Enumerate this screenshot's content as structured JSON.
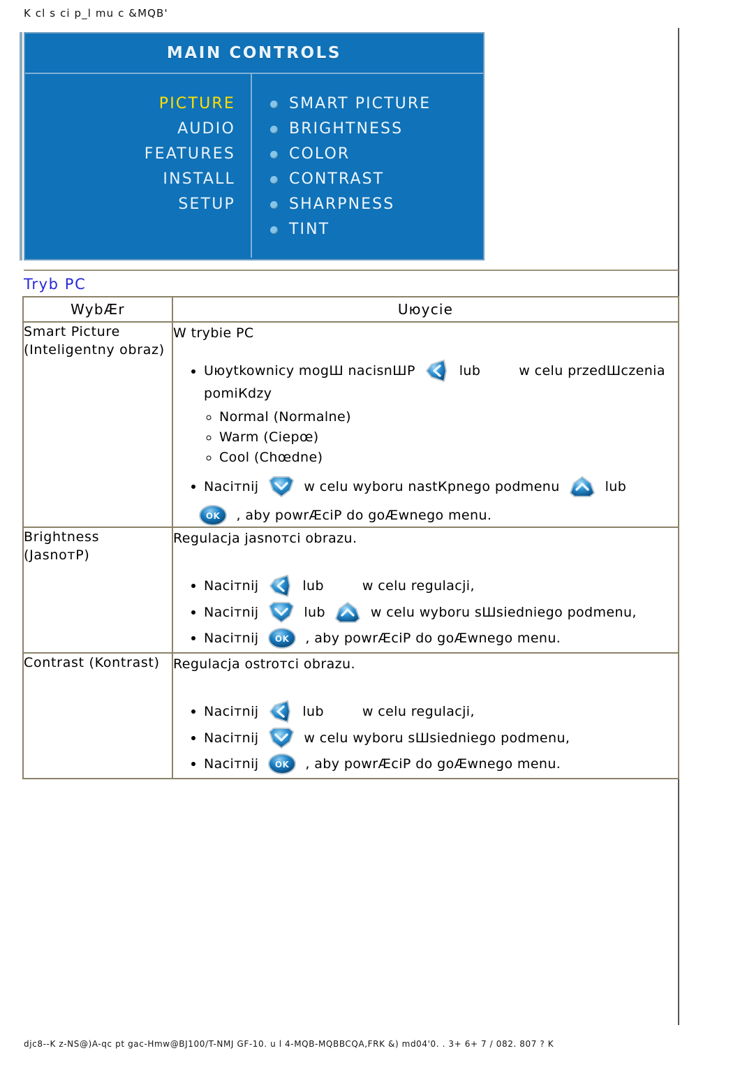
{
  "header": {
    "breadcrumb": "K cl s ci p_l mu c &MQB'"
  },
  "osd": {
    "title": "MAIN  CONTROLS",
    "categories": [
      {
        "label": "PICTURE",
        "selected": true
      },
      {
        "label": "AUDIO",
        "selected": false
      },
      {
        "label": "FEATURES",
        "selected": false
      },
      {
        "label": "INSTALL",
        "selected": false
      },
      {
        "label": "SETUP",
        "selected": false
      }
    ],
    "submenu": [
      "SMART PICTURE",
      "BRIGHTNESS",
      "COLOR",
      "CONTRAST",
      "SHARPNESS",
      "TINT"
    ],
    "colors": {
      "background": "#1072b8",
      "border": "#6f9fc4",
      "text": "#eaf4fb",
      "selected_text": "#ffe000",
      "bullet": "#86c5e8"
    }
  },
  "section": {
    "title": "Tryb PC",
    "title_color": "#2727d8"
  },
  "table": {
    "headers": {
      "selection": "WybÆr",
      "usage": "Uюycie"
    },
    "rows": [
      {
        "label_line1": "Smart Picture",
        "label_line2": "(Inteligentny obraz)",
        "lead": "W trybie PC",
        "bullets": [
          {
            "pre": "Uюytkownicy mogШ nacisnШP",
            "icon1": "left-arrow-button-icon",
            "mid": "lub",
            "icon2": "right-arrow-button-icon",
            "post": "w celu przedШczenia pomiКdzy"
          },
          {
            "pre": "Naciтnij",
            "icon1": "down-arrow-button-icon",
            "mid": "w celu wyboru nastКpnego podmenu",
            "icon2": "up-arrow-button-icon",
            "post": "lub"
          }
        ],
        "sub_options": [
          "Normal (Normalne)",
          "Warm (Ciepœ)",
          "Cool (Chœdne)"
        ],
        "closing": {
          "icon": "ok-button-icon",
          "text": ", aby powrÆciP do goÆwnego menu."
        }
      },
      {
        "label_line1": "Brightness",
        "label_line2": "(JasnoтP)",
        "lead": "Regulacja jasnoтci obrazu.",
        "bullets": [
          {
            "pre": "Naciтnij",
            "icon1": "left-arrow-button-icon",
            "mid": "lub",
            "icon2": "right-arrow-button-icon",
            "post": "w celu regulacji,"
          },
          {
            "pre": "Naciтnij",
            "icon1": "down-arrow-button-icon",
            "mid": "lub",
            "icon2": "up-arrow-button-icon",
            "post": "w celu wyboru sШsiedniego podmenu,"
          },
          {
            "pre": "Naciтnij",
            "icon1": "ok-button-icon",
            "mid": "",
            "icon2": "",
            "post": ", aby powrÆciP do goÆwnego menu."
          }
        ]
      },
      {
        "label_line1": "Contrast (Kontrast)",
        "label_line2": "",
        "lead": "Regulacja ostroтci obrazu.",
        "bullets": [
          {
            "pre": "Naciтnij",
            "icon1": "left-arrow-button-icon",
            "mid": "lub",
            "icon2": "right-arrow-button-icon",
            "post": "w celu regulacji,"
          },
          {
            "pre": "Naciтnij",
            "icon1": "down-arrow-button-icon",
            "mid": "",
            "icon2": "",
            "post": "w celu wyboru sШsiedniego podmenu,"
          },
          {
            "pre": "Naciтnij",
            "icon1": "ok-button-icon",
            "mid": "",
            "icon2": "",
            "post": ", aby powrÆciP do goÆwnego menu."
          }
        ]
      }
    ]
  },
  "footer": {
    "text": "djc8--K z-NS@)A-qc pt gac-Hmw@BJ100/T-NMJ GF-10. u l 4-MQB-MQBBCQA,FRK &) md04'0. . 3+ 6+ 7 / 082. 807 ? K"
  }
}
